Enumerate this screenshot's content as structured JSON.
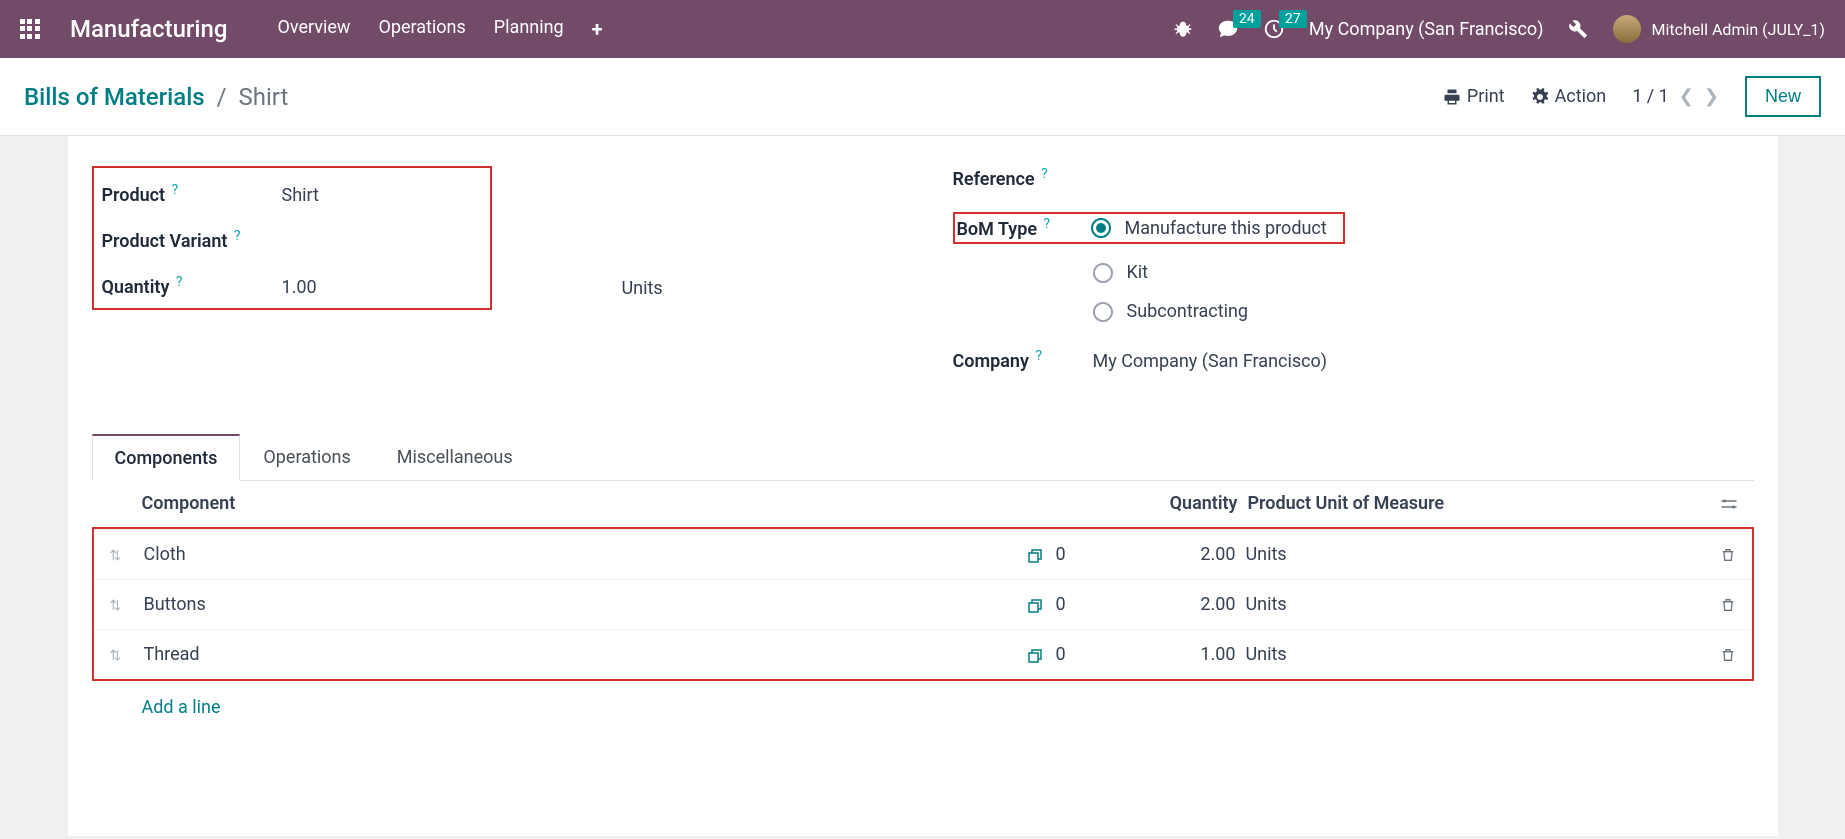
{
  "navbar": {
    "title": "Manufacturing",
    "menu": [
      "Overview",
      "Operations",
      "Planning"
    ],
    "messages_badge": "24",
    "activities_badge": "27",
    "company": "My Company (San Francisco)",
    "user": "Mitchell Admin (JULY_1)"
  },
  "breadcrumb": {
    "parent": "Bills of Materials",
    "current": "Shirt",
    "print": "Print",
    "action": "Action",
    "pager": "1 / 1",
    "new": "New"
  },
  "form": {
    "product_label": "Product",
    "product_value": "Shirt",
    "variant_label": "Product Variant",
    "quantity_label": "Quantity",
    "quantity_value": "1.00",
    "quantity_uom": "Units",
    "reference_label": "Reference",
    "bom_type_label": "BoM Type",
    "bom_type_options": [
      "Manufacture this product",
      "Kit",
      "Subcontracting"
    ],
    "company_label": "Company",
    "company_value": "My Company (San Francisco)"
  },
  "tabs": [
    "Components",
    "Operations",
    "Miscellaneous"
  ],
  "table": {
    "headers": {
      "component": "Component",
      "quantity": "Quantity",
      "uom": "Product Unit of Measure"
    },
    "rows": [
      {
        "component": "Cloth",
        "extra": "0",
        "qty": "2.00",
        "uom": "Units"
      },
      {
        "component": "Buttons",
        "extra": "0",
        "qty": "2.00",
        "uom": "Units"
      },
      {
        "component": "Thread",
        "extra": "0",
        "qty": "1.00",
        "uom": "Units"
      }
    ],
    "add_line": "Add a line"
  }
}
